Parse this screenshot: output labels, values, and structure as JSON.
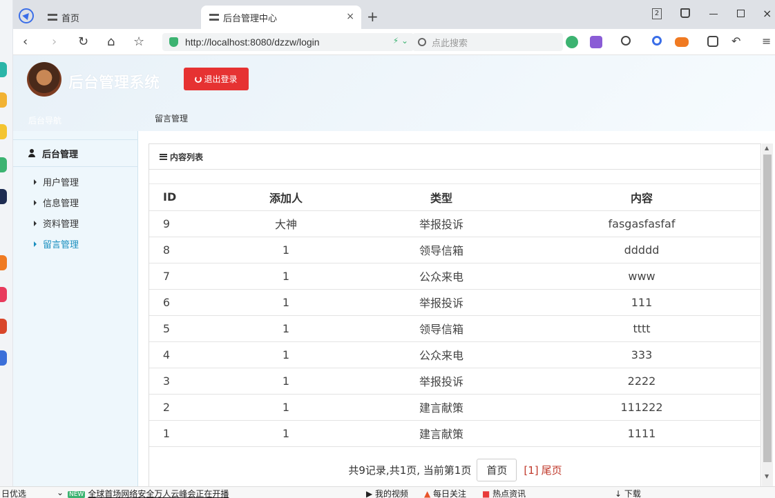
{
  "browser": {
    "tabs": [
      {
        "label": "首页"
      },
      {
        "label": "后台管理中心"
      }
    ],
    "tab_close": "×",
    "new_tab": "+",
    "tab_count": "2",
    "url": "http://localhost:8080/dzzw/login",
    "search_placeholder": "点此搜索"
  },
  "header": {
    "title": "后台管理系统",
    "logout_label": "退出登录",
    "side_top_label": "后台导航",
    "breadcrumb": "留言管理"
  },
  "sidebar": {
    "heading": "后台管理",
    "items": [
      {
        "label": "用户管理",
        "active": false
      },
      {
        "label": "信息管理",
        "active": false
      },
      {
        "label": "资料管理",
        "active": false
      },
      {
        "label": "留言管理",
        "active": true
      }
    ]
  },
  "panel": {
    "title": "内容列表",
    "columns": [
      "ID",
      "添加人",
      "类型",
      "内容"
    ],
    "rows": [
      {
        "id": "9",
        "adder": "大神",
        "type": "举报投诉",
        "content": "fasgasfasfaf"
      },
      {
        "id": "8",
        "adder": "1",
        "type": "领导信箱",
        "content": "ddddd"
      },
      {
        "id": "7",
        "adder": "1",
        "type": "公众来电",
        "content": "www"
      },
      {
        "id": "6",
        "adder": "1",
        "type": "举报投诉",
        "content": "111"
      },
      {
        "id": "5",
        "adder": "1",
        "type": "领导信箱",
        "content": "tttt"
      },
      {
        "id": "4",
        "adder": "1",
        "type": "公众来电",
        "content": "333"
      },
      {
        "id": "3",
        "adder": "1",
        "type": "举报投诉",
        "content": "2222"
      },
      {
        "id": "2",
        "adder": "1",
        "type": "建言献策",
        "content": "111222"
      },
      {
        "id": "1",
        "adder": "1",
        "type": "建言献策",
        "content": "1111"
      }
    ],
    "pager": {
      "summary": "共9记录,共1页, 当前第1页",
      "first": "首页",
      "current": "[1]",
      "last": "尾页"
    }
  },
  "statusbar": {
    "left": "日优选",
    "news_badge": "NEW",
    "news": "全球首场网络安全万人云峰会正在开播",
    "video": "我的视频",
    "daily": "每日关注",
    "hot": "热点资讯",
    "download": "下载"
  },
  "colors": {
    "logout": "#e63232",
    "active_nav": "#1a8fbf",
    "pager_red": "#c0392b"
  }
}
